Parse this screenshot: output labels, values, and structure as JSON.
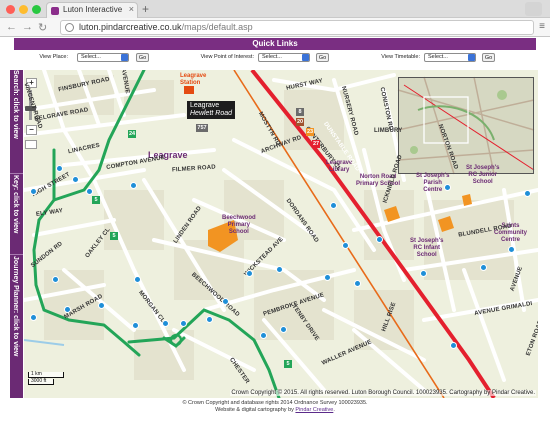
{
  "browser": {
    "tab_title": "Luton Interactive Mapping, h",
    "url_host": "luton.pindarcreative.co.uk",
    "url_path": "/maps/default.asp",
    "tab_close_glyph": "×",
    "new_tab_glyph": "+",
    "back_glyph": "←",
    "forward_glyph": "→",
    "reload_glyph": "↻",
    "menu_glyph": "≡"
  },
  "quick_links": {
    "title": "Quick Links",
    "view_place": {
      "label": "View Place:",
      "value": "Select...",
      "go": "Go"
    },
    "view_poi": {
      "label": "View Point of Interest:",
      "value": "Select...",
      "go": "Go"
    },
    "view_timetable": {
      "label": "View Timetable:",
      "value": "Select...",
      "go": "Go"
    }
  },
  "side_tabs": {
    "search": "Search: click to view",
    "key": "Key: click to view",
    "journey": "Journey Planner: click to view"
  },
  "map": {
    "controls": {
      "zoom_in": "+",
      "zoom_out": "−"
    },
    "callout": {
      "title": "Leagrave",
      "subtitle": "Hewlett Road"
    },
    "place_label": "Leagrave",
    "station_label_1": "Leagrave",
    "station_label_2": "Station",
    "pois": {
      "library_1": "Leagrave",
      "library_2": "Library",
      "beechwood_1": "Beechwood",
      "beechwood_2": "Primary",
      "beechwood_3": "School",
      "norton_1": "Norton Road",
      "norton_2": "Primary School",
      "stjp_1": "St Joseph's",
      "stjp_2": "Parish",
      "stjp_3": "Centre",
      "stjj_1": "St Joseph's",
      "stjj_2": "RC Junior",
      "stjj_3": "School",
      "stji_1": "St Joseph's",
      "stji_2": "RC Infant",
      "stji_3": "School",
      "saints_1": "Saints",
      "saints_2": "Community",
      "saints_3": "Centre"
    },
    "roads": {
      "vincent": "VINCENT ROAD",
      "finsbury": "FINSBURY ROAD",
      "belgrave": "BELGRAVE ROAD",
      "linacres": "LINACRES",
      "compton": "COMPTON AVENUE",
      "filmer": "FILMER ROAD",
      "high_street": "HIGH STREET",
      "ely": "ELY WAY",
      "oakley": "OAKLEY CL",
      "linden": "LINDEN ROAD",
      "wickstead": "WICKSTEAD AVE",
      "dordans": "DORDANS ROAD",
      "beechwood": "BEECHWOOD ROAD",
      "morgan": "MORGAN CL",
      "pembroke": "PEMBROKE AVENUE",
      "tenby": "TENBY DRIVE",
      "waller": "WALLER AVENUE",
      "chester": "CHESTER",
      "canterbury": "CANTERBURY CL",
      "archway": "ARCHWAY RD",
      "mostyn": "MOSTYN RD",
      "hurst": "HURST WAY",
      "nursery": "NURSERY ROAD",
      "coniston": "CONISTON RD",
      "limbury": "LIMBURY",
      "icknield": "ICKNIELD ROAD",
      "blundell": "BLUNDELL ROAD",
      "avenue_grimaldi": "AVENUE GRIMALDI",
      "norton": "NORTON ROAD",
      "dunstable": "DUNSTABLE ROAD",
      "avenue_right": "AVENUE",
      "eton": "ETON ROAD",
      "hill_rise": "HILL RISE",
      "avenue_left": "AVENUE",
      "sundon": "SUNDON RD",
      "marsh": "MARSH ROAD"
    },
    "numbers": {
      "n757": "757",
      "n20": "20",
      "n23": "23",
      "n27": "27",
      "n24": "24",
      "n5a": "5",
      "n5b": "5",
      "n5c": "5",
      "n8": "8"
    },
    "scale": {
      "km": "1 km",
      "ft": "3000 ft"
    },
    "copyright": "Crown Copyright © 2015. All rights reserved. Luton Borough Council. 100023935. Cartography by Pindar Creative."
  },
  "footer": {
    "line1": "© Crown Copyright and database rights 2014 Ordnance Survey 100023935.",
    "line2_prefix": "Website & digital cartography by ",
    "line2_link": "Pindar Creative",
    "line2_suffix": "."
  },
  "colors": {
    "brand_purple": "#7a2e82",
    "map_background": "#eef0de",
    "red_road": "#e4202e",
    "orange_rail": "#e86b1a",
    "bus_route_green": "#23a558",
    "school_orange": "#f29422"
  }
}
